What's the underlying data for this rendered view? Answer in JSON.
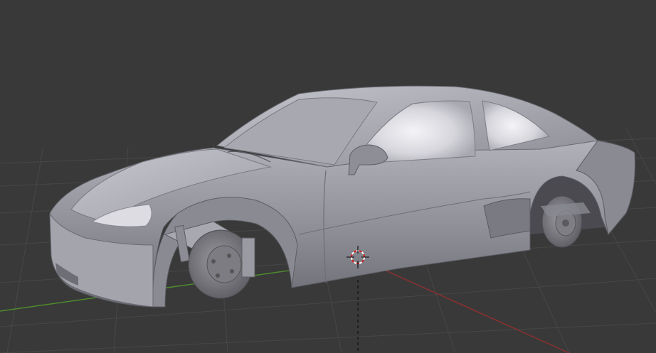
{
  "viewport": {
    "name": "3d-viewport",
    "background_color": "#393939",
    "grid_color": "#4a4a4a",
    "x_axis_color": "#8a3030",
    "y_axis_color": "#4e8a2e",
    "z_axis_style": "dashed-black"
  },
  "scene": {
    "object": "car-body-mesh",
    "object_shading": "solid-gray",
    "body_color": "#9a9aa2",
    "window_highlight_color": "#e6e6ea",
    "wheel_color": "#6c6c70",
    "cursor_3d": {
      "ring_colors": [
        "#d22020",
        "#ffffff"
      ],
      "crosshair_color": "#000000"
    }
  }
}
